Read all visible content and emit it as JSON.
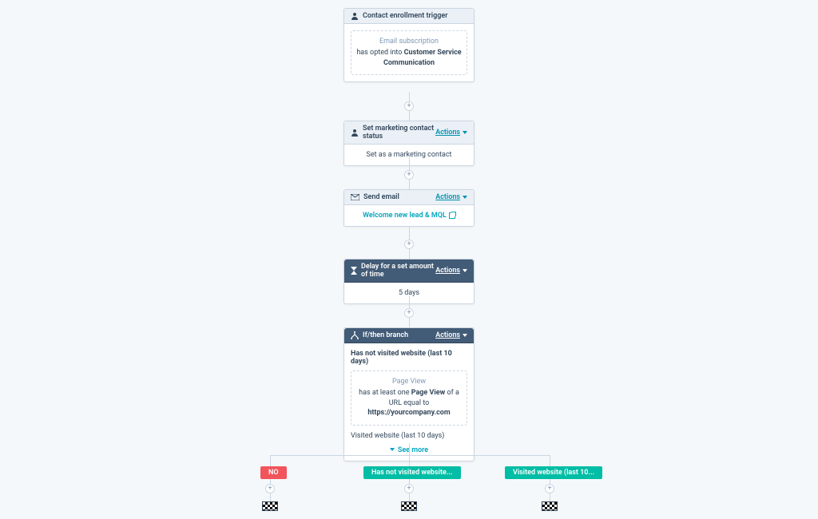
{
  "actions_label": "Actions",
  "nodes": {
    "trigger": {
      "title": "Contact enrollment trigger",
      "sub": "Email subscription",
      "line_pre": "has opted into ",
      "line_bold": "Customer Service Communication"
    },
    "set_status": {
      "title": "Set marketing contact status",
      "body": "Set as a marketing contact"
    },
    "send_email": {
      "title": "Send email",
      "link": "Welcome new lead & MQL"
    },
    "delay": {
      "title": "Delay for a set amount of time",
      "body": "5 days"
    },
    "branch": {
      "title": "If/then branch",
      "cond1_title": "Has not visited website (last 10 days)",
      "pv_sub": "Page View",
      "pv_pre": "has at least one ",
      "pv_bold1": "Page View",
      "pv_mid": " of a URL equal to ",
      "pv_bold2": "https://yourcompany.com",
      "cond2_title": "Visited website (last 10 days)",
      "see_more": "See more"
    }
  },
  "pills": {
    "no": "NO",
    "notvisited": "Has not visited website...",
    "visited": "Visited website (last 10..."
  }
}
